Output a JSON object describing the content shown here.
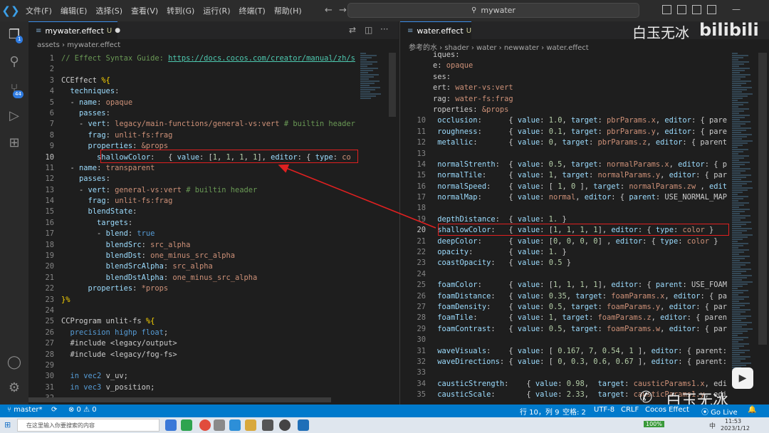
{
  "titlebar": {
    "menu": [
      "文件(F)",
      "编辑(E)",
      "选择(S)",
      "查看(V)",
      "转到(G)",
      "运行(R)",
      "终端(T)",
      "帮助(H)"
    ],
    "search_text": "mywater"
  },
  "activity": {
    "badge1": "1",
    "badge2": "44"
  },
  "left_editor": {
    "tab_label": "mywater.effect",
    "tab_status": "U",
    "breadcrumb": "assets  ›  mywater.effect",
    "current_line": 10,
    "lines": [
      {
        "n": "1",
        "html": "<span class=\"c\">// Effect Syntax Guide: </span><span class=\"u\">https://docs.cocos.com/creator/manual/zh/s</span>"
      },
      {
        "n": "2",
        "html": ""
      },
      {
        "n": "3",
        "html": "<span class=\"t\">CCEffect </span><span class=\"y\">%{</span>"
      },
      {
        "n": "4",
        "html": "  <span class=\"k\">techniques</span><span class=\"t\">:</span>"
      },
      {
        "n": "5",
        "html": "  <span class=\"t\">- </span><span class=\"k\">name</span><span class=\"t\">: </span><span class=\"s\">opaque</span>"
      },
      {
        "n": "6",
        "html": "    <span class=\"k\">passes</span><span class=\"t\">:</span>"
      },
      {
        "n": "7",
        "html": "    <span class=\"t\">- </span><span class=\"k\">vert</span><span class=\"t\">: </span><span class=\"s\">legacy/main-functions/general-vs:vert </span><span class=\"c\"># builtin header</span>"
      },
      {
        "n": "8",
        "html": "      <span class=\"k\">frag</span><span class=\"t\">: </span><span class=\"s\">unlit-fs:frag</span>"
      },
      {
        "n": "9",
        "html": "      <span class=\"k\">properties</span><span class=\"t\">: </span><span class=\"s\">&amp;props</span>"
      },
      {
        "n": "10",
        "html": "        <span class=\"k\">shallowColor</span><span class=\"t\">:   { </span><span class=\"k\">value</span><span class=\"t\">: [</span><span class=\"n\">1</span><span class=\"t\">, </span><span class=\"n\">1</span><span class=\"t\">, </span><span class=\"n\">1</span><span class=\"t\">, </span><span class=\"n\">1</span><span class=\"t\">], </span><span class=\"k\">editor</span><span class=\"t\">: { </span><span class=\"k\">type</span><span class=\"t\">: </span><span class=\"s\">co</span>"
      },
      {
        "n": "11",
        "html": "  <span class=\"t\">- </span><span class=\"k\">name</span><span class=\"t\">: </span><span class=\"s\">transparent</span>"
      },
      {
        "n": "12",
        "html": "    <span class=\"k\">passes</span><span class=\"t\">:</span>"
      },
      {
        "n": "13",
        "html": "    <span class=\"t\">- </span><span class=\"k\">vert</span><span class=\"t\">: </span><span class=\"s\">general-vs:vert </span><span class=\"c\"># builtin header</span>"
      },
      {
        "n": "14",
        "html": "      <span class=\"k\">frag</span><span class=\"t\">: </span><span class=\"s\">unlit-fs:frag</span>"
      },
      {
        "n": "15",
        "html": "      <span class=\"k\">blendState</span><span class=\"t\">:</span>"
      },
      {
        "n": "16",
        "html": "        <span class=\"k\">targets</span><span class=\"t\">:</span>"
      },
      {
        "n": "17",
        "html": "        <span class=\"t\">- </span><span class=\"k\">blend</span><span class=\"t\">: </span><span class=\"b\">true</span>"
      },
      {
        "n": "18",
        "html": "          <span class=\"k\">blendSrc</span><span class=\"t\">: </span><span class=\"s\">src_alpha</span>"
      },
      {
        "n": "19",
        "html": "          <span class=\"k\">blendDst</span><span class=\"t\">: </span><span class=\"s\">one_minus_src_alpha</span>"
      },
      {
        "n": "20",
        "html": "          <span class=\"k\">blendSrcAlpha</span><span class=\"t\">: </span><span class=\"s\">src_alpha</span>"
      },
      {
        "n": "21",
        "html": "          <span class=\"k\">blendDstAlpha</span><span class=\"t\">: </span><span class=\"s\">one_minus_src_alpha</span>"
      },
      {
        "n": "22",
        "html": "      <span class=\"k\">properties</span><span class=\"t\">: </span><span class=\"s\">*props</span>"
      },
      {
        "n": "23",
        "html": "<span class=\"y\">}%</span>"
      },
      {
        "n": "24",
        "html": ""
      },
      {
        "n": "25",
        "html": "<span class=\"t\">CCProgram unlit-fs </span><span class=\"y\">%{</span>"
      },
      {
        "n": "26",
        "html": "  <span class=\"b\">precision highp float</span><span class=\"t\">;</span>"
      },
      {
        "n": "27",
        "html": "  <span class=\"t\">#include &lt;legacy/output&gt;</span>"
      },
      {
        "n": "28",
        "html": "  <span class=\"t\">#include &lt;legacy/fog-fs&gt;</span>"
      },
      {
        "n": "29",
        "html": ""
      },
      {
        "n": "30",
        "html": "  <span class=\"b\">in vec2 </span><span class=\"t\">v_uv;</span>"
      },
      {
        "n": "31",
        "html": "  <span class=\"b\">in vec3 </span><span class=\"t\">v_position;</span>"
      },
      {
        "n": "32",
        "html": ""
      }
    ]
  },
  "right_editor": {
    "tab_label": "water.effect",
    "tab_status": "U",
    "breadcrumb": "参考的水  ›  shader  ›  water  ›  newwater  ›  water.effect",
    "current_line": 20,
    "lines": [
      {
        "n": "",
        "html": "<span class=\"t\">iques:</span>"
      },
      {
        "n": "",
        "html": "<span class=\"t\">e: </span><span class=\"s\">opaque</span>"
      },
      {
        "n": "",
        "html": "<span class=\"t\">ses:</span>"
      },
      {
        "n": "",
        "html": "<span class=\"t\">ert: </span><span class=\"s\">water-vs:vert</span>"
      },
      {
        "n": "",
        "html": "<span class=\"t\">rag: </span><span class=\"s\">water-fs:frag</span>"
      },
      {
        "n": "",
        "html": "<span class=\"t\">roperties: </span><span class=\"s\">&amp;props</span>"
      },
      {
        "n": "10",
        "html": " <span class=\"k\">occlusion</span><span class=\"t\">:      { </span><span class=\"k\">value</span><span class=\"t\">: </span><span class=\"n\">1.0</span><span class=\"t\">, </span><span class=\"k\">target</span><span class=\"t\">: </span><span class=\"s\">pbrParams.x</span><span class=\"t\">, </span><span class=\"k\">editor</span><span class=\"t\">: { pare</span>"
      },
      {
        "n": "11",
        "html": " <span class=\"k\">roughness</span><span class=\"t\">:      { </span><span class=\"k\">value</span><span class=\"t\">: </span><span class=\"n\">0.1</span><span class=\"t\">, </span><span class=\"k\">target</span><span class=\"t\">: </span><span class=\"s\">pbrParams.y</span><span class=\"t\">, </span><span class=\"k\">editor</span><span class=\"t\">: { pare</span>"
      },
      {
        "n": "12",
        "html": " <span class=\"k\">metallic</span><span class=\"t\">:       { </span><span class=\"k\">value</span><span class=\"t\">: </span><span class=\"n\">0</span><span class=\"t\">, </span><span class=\"k\">target</span><span class=\"t\">: </span><span class=\"s\">pbrParams.z</span><span class=\"t\">, </span><span class=\"k\">editor</span><span class=\"t\">: { parent</span>"
      },
      {
        "n": "13",
        "html": ""
      },
      {
        "n": "14",
        "html": " <span class=\"k\">normalStrenth</span><span class=\"t\">:  { </span><span class=\"k\">value</span><span class=\"t\">: </span><span class=\"n\">0.5</span><span class=\"t\">, </span><span class=\"k\">target</span><span class=\"t\">: </span><span class=\"s\">normalParams.x</span><span class=\"t\">, </span><span class=\"k\">editor</span><span class=\"t\">: { p</span>"
      },
      {
        "n": "15",
        "html": " <span class=\"k\">normalTile</span><span class=\"t\">:     { </span><span class=\"k\">value</span><span class=\"t\">: </span><span class=\"n\">1</span><span class=\"t\">, </span><span class=\"k\">target</span><span class=\"t\">: </span><span class=\"s\">normalParams.y</span><span class=\"t\">, </span><span class=\"k\">editor</span><span class=\"t\">: { par</span>"
      },
      {
        "n": "16",
        "html": " <span class=\"k\">normalSpeed</span><span class=\"t\">:    { </span><span class=\"k\">value</span><span class=\"t\">: [ </span><span class=\"n\">1</span><span class=\"t\">, </span><span class=\"n\">0</span><span class=\"t\"> ], </span><span class=\"k\">target</span><span class=\"t\">: </span><span class=\"s\">normalParams.zw</span><span class=\"t\"> , </span><span class=\"k\">edit</span>"
      },
      {
        "n": "17",
        "html": " <span class=\"k\">normalMap</span><span class=\"t\">:      { </span><span class=\"k\">value</span><span class=\"t\">: </span><span class=\"s\">normal</span><span class=\"t\">, </span><span class=\"k\">editor</span><span class=\"t\">: { </span><span class=\"k\">parent</span><span class=\"t\">: USE_NORMAL_MAP</span>"
      },
      {
        "n": "18",
        "html": ""
      },
      {
        "n": "19",
        "html": " <span class=\"k\">depthDistance</span><span class=\"t\">:  { </span><span class=\"k\">value</span><span class=\"t\">: </span><span class=\"n\">1.</span><span class=\"t\"> }</span>"
      },
      {
        "n": "20",
        "html": " <span class=\"k\">shallowColor</span><span class=\"t\">:   { </span><span class=\"k\">value</span><span class=\"t\">: [</span><span class=\"n\">1</span><span class=\"t\">, </span><span class=\"n\">1</span><span class=\"t\">, </span><span class=\"n\">1</span><span class=\"t\">, </span><span class=\"n\">1</span><span class=\"t\">], </span><span class=\"k\">editor</span><span class=\"t\">: { </span><span class=\"k\">type</span><span class=\"t\">: </span><span class=\"s\">color</span><span class=\"t\"> }</span>"
      },
      {
        "n": "21",
        "html": " <span class=\"k\">deepColor</span><span class=\"t\">:      { </span><span class=\"k\">value</span><span class=\"t\">: [</span><span class=\"n\">0</span><span class=\"t\">, </span><span class=\"n\">0</span><span class=\"t\">, </span><span class=\"n\">0</span><span class=\"t\">, </span><span class=\"n\">0</span><span class=\"t\">] , </span><span class=\"k\">editor</span><span class=\"t\">: { </span><span class=\"k\">type</span><span class=\"t\">: </span><span class=\"s\">color</span><span class=\"t\"> }</span>"
      },
      {
        "n": "22",
        "html": " <span class=\"k\">opacity</span><span class=\"t\">:        { </span><span class=\"k\">value</span><span class=\"t\">: </span><span class=\"n\">1.</span><span class=\"t\"> }</span>"
      },
      {
        "n": "23",
        "html": " <span class=\"k\">coastOpacity</span><span class=\"t\">:   { </span><span class=\"k\">value</span><span class=\"t\">: </span><span class=\"n\">0.5</span><span class=\"t\"> }</span>"
      },
      {
        "n": "24",
        "html": ""
      },
      {
        "n": "25",
        "html": " <span class=\"k\">foamColor</span><span class=\"t\">:      { </span><span class=\"k\">value</span><span class=\"t\">: [</span><span class=\"n\">1</span><span class=\"t\">, </span><span class=\"n\">1</span><span class=\"t\">, </span><span class=\"n\">1</span><span class=\"t\">, </span><span class=\"n\">1</span><span class=\"t\">], </span><span class=\"k\">editor</span><span class=\"t\">: { </span><span class=\"k\">parent</span><span class=\"t\">: USE_FOAM</span>"
      },
      {
        "n": "26",
        "html": " <span class=\"k\">foamDistance</span><span class=\"t\">:   { </span><span class=\"k\">value</span><span class=\"t\">: </span><span class=\"n\">0.35</span><span class=\"t\">, </span><span class=\"k\">target</span><span class=\"t\">: </span><span class=\"s\">foamParams.x</span><span class=\"t\">, </span><span class=\"k\">editor</span><span class=\"t\">: { pa</span>"
      },
      {
        "n": "27",
        "html": " <span class=\"k\">foamDensity</span><span class=\"t\">:    { </span><span class=\"k\">value</span><span class=\"t\">: </span><span class=\"n\">0.5</span><span class=\"t\">, </span><span class=\"k\">target</span><span class=\"t\">: </span><span class=\"s\">foamParams.y</span><span class=\"t\">, </span><span class=\"k\">editor</span><span class=\"t\">: { par</span>"
      },
      {
        "n": "28",
        "html": " <span class=\"k\">foamTile</span><span class=\"t\">:       { </span><span class=\"k\">value</span><span class=\"t\">: </span><span class=\"n\">1</span><span class=\"t\">, </span><span class=\"k\">target</span><span class=\"t\">: </span><span class=\"s\">foamParams.z</span><span class=\"t\">, </span><span class=\"k\">editor</span><span class=\"t\">: { paren</span>"
      },
      {
        "n": "29",
        "html": " <span class=\"k\">foamContrast</span><span class=\"t\">:   { </span><span class=\"k\">value</span><span class=\"t\">: </span><span class=\"n\">0.5</span><span class=\"t\">, </span><span class=\"k\">target</span><span class=\"t\">: </span><span class=\"s\">foamParams.w</span><span class=\"t\">, </span><span class=\"k\">editor</span><span class=\"t\">: { par</span>"
      },
      {
        "n": "30",
        "html": ""
      },
      {
        "n": "31",
        "html": " <span class=\"k\">waveVisuals</span><span class=\"t\">:    { </span><span class=\"k\">value</span><span class=\"t\">: [ </span><span class=\"n\">0.167</span><span class=\"t\">, </span><span class=\"n\">7</span><span class=\"t\">, </span><span class=\"n\">0.54</span><span class=\"t\">, </span><span class=\"n\">1</span><span class=\"t\"> ], </span><span class=\"k\">editor</span><span class=\"t\">: { parent:</span>"
      },
      {
        "n": "32",
        "html": " <span class=\"k\">waveDirections</span><span class=\"t\">: { </span><span class=\"k\">value</span><span class=\"t\">: [ </span><span class=\"n\">0</span><span class=\"t\">, </span><span class=\"n\">0.3</span><span class=\"t\">, </span><span class=\"n\">0.6</span><span class=\"t\">, </span><span class=\"n\">0.67</span><span class=\"t\"> ], </span><span class=\"k\">editor</span><span class=\"t\">: { parent:</span>"
      },
      {
        "n": "33",
        "html": ""
      },
      {
        "n": "34",
        "html": " <span class=\"k\">causticStrength</span><span class=\"t\">:    { </span><span class=\"k\">value</span><span class=\"t\">: </span><span class=\"n\">0.98</span><span class=\"t\">,  </span><span class=\"k\">target</span><span class=\"t\">: </span><span class=\"s\">causticParams1.x</span><span class=\"t\">, edi</span>"
      },
      {
        "n": "35",
        "html": " <span class=\"k\">causticScale</span><span class=\"t\">:       { </span><span class=\"k\">value</span><span class=\"t\">: </span><span class=\"n\">2.33</span><span class=\"t\">,  </span><span class=\"k\">target</span><span class=\"t\">: </span><span class=\"s\">causticParams1.y</span><span class=\"t\">, edi</span>"
      }
    ]
  },
  "statusbar": {
    "branch": "master*",
    "problems": "⊗ 0 ⚠ 0",
    "position": "行 10，列 9",
    "spaces": "空格: 2",
    "encoding": "UTF-8",
    "eol": "CRLF",
    "language": "Cocos Effect",
    "golive": "⦿ Go Live"
  },
  "taskbar": {
    "search_placeholder": "在这里输入你要搜索的内容",
    "battery": "100%",
    "ime": "中",
    "time": "11:53",
    "date": "2023/1/12"
  },
  "watermark": {
    "top_text": "白玉无冰",
    "bili": "bilibili",
    "bottom_text": "白玉无冰"
  }
}
